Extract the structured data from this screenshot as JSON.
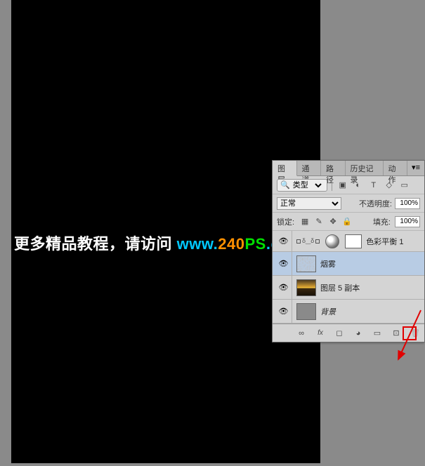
{
  "watermark": {
    "text_cn": "更多精品教程，请访问 ",
    "www": "www.",
    "num": "240",
    "ps": "PS",
    "com": ".com"
  },
  "panel": {
    "tabs": [
      "图层",
      "通道",
      "路径",
      "历史记录",
      "动作"
    ],
    "active_tab": 0,
    "filter_label": "类型",
    "blend_mode": "正常",
    "opacity_label": "不透明度:",
    "opacity_value": "100%",
    "lock_label": "锁定:",
    "fill_label": "填充:",
    "fill_value": "100%"
  },
  "layers": [
    {
      "name": "色彩平衡 1",
      "type": "adjustment",
      "visible": true
    },
    {
      "name": "烟雾",
      "type": "normal",
      "visible": true,
      "selected": true,
      "thumb": "clouds"
    },
    {
      "name": "图层 5 副本",
      "type": "normal",
      "visible": true,
      "thumb": "sunset"
    },
    {
      "name": "背景",
      "type": "bg",
      "visible": true,
      "thumb": "gray",
      "italic": true
    }
  ],
  "icons": {
    "search": "🔍",
    "image": "▣",
    "adjust": "◐",
    "text": "T",
    "shape": "◇",
    "smart": "▭",
    "eye": "👁",
    "link": "⧉",
    "fx": "fx",
    "mask": "◻",
    "fill": "◕",
    "folder": "📁",
    "new": "⊞",
    "trash": "🗑",
    "chainlink": "∞",
    "lock": "🔒",
    "menu": "≡"
  }
}
